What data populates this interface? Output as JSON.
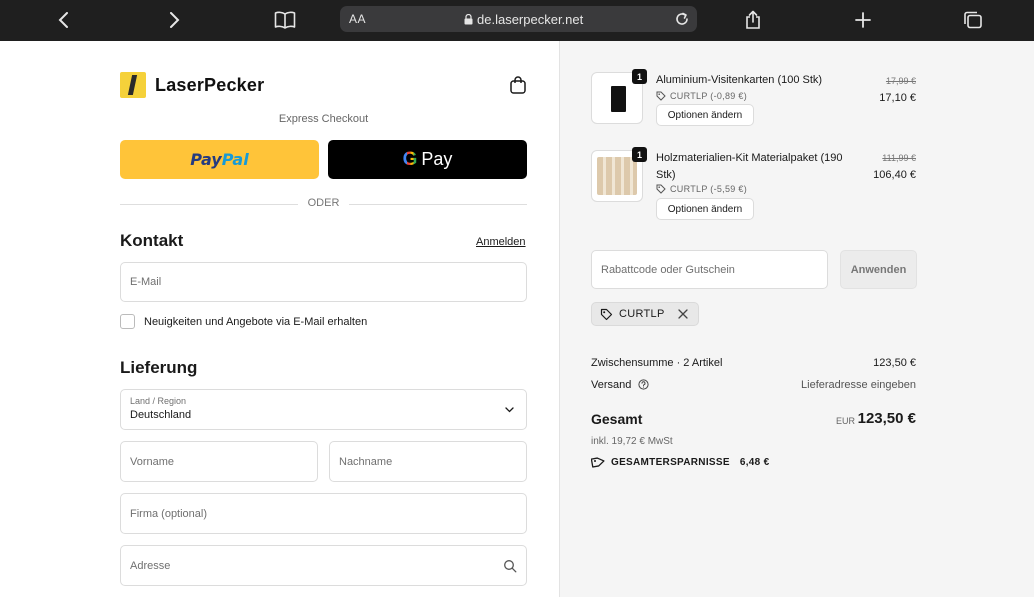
{
  "browser": {
    "aa_label": "AA",
    "url": "de.laserpecker.net"
  },
  "brand": {
    "name": "LaserPecker"
  },
  "checkout": {
    "express_label": "Express Checkout",
    "paypal_a": "Pay",
    "paypal_b": "Pal",
    "gpay_label": "Pay",
    "divider_label": "ODER"
  },
  "contact": {
    "heading": "Kontakt",
    "login_link": "Anmelden",
    "email_placeholder": "E-Mail",
    "newsletter_label": "Neuigkeiten und Angebote via E-Mail erhalten"
  },
  "delivery": {
    "heading": "Lieferung",
    "country_label": "Land / Region",
    "country_value": "Deutschland",
    "firstname_placeholder": "Vorname",
    "lastname_placeholder": "Nachname",
    "company_placeholder": "Firma (optional)",
    "address_placeholder": "Adresse"
  },
  "cart": {
    "items": [
      {
        "qty": "1",
        "title": "Aluminium-Visitenkarten (100 Stk)",
        "code": "CURTLP (-0,89 €)",
        "options_label": "Optionen ändern",
        "price_old": "17,99 €",
        "price_new": "17,10 €"
      },
      {
        "qty": "1",
        "title_line1": "Holzmaterialien-Kit Materialpaket (190",
        "title_line2": "Stk)",
        "code": "CURTLP (-5,59 €)",
        "options_label": "Optionen ändern",
        "price_old": "111,99 €",
        "price_new": "106,40 €"
      }
    ],
    "discount_placeholder": "Rabattcode oder Gutschein",
    "apply_label": "Anwenden",
    "applied_code": "CURTLP"
  },
  "summary": {
    "subtotal_label": "Zwischensumme · 2 Artikel",
    "subtotal_value": "123,50 €",
    "shipping_label": "Versand",
    "shipping_value": "Lieferadresse eingeben",
    "total_label": "Gesamt",
    "currency": "EUR",
    "total_value": "123,50 €",
    "tax_note": "inkl. 19,72 € MwSt",
    "savings_label": "GESAMTERSPARNISSE",
    "savings_value": "6,48 €"
  }
}
